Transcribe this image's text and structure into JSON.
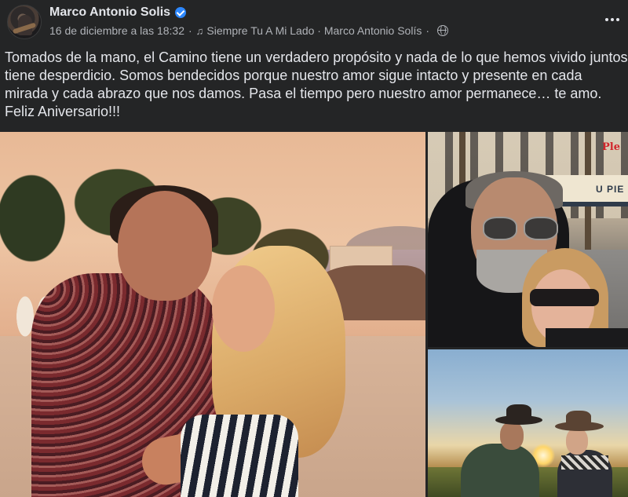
{
  "post": {
    "author": "Marco Antonio Solis",
    "date": "16 de diciembre a las 18:32",
    "separator": "·",
    "song": "Siempre Tu A Mi Lado · Marco Antonio Solís",
    "audience_icon": "globe-icon",
    "music_icon": "music-note-icon",
    "verified": true,
    "caption": "Tomados de la mano, el Camino tiene un verdadero propósito y nada de lo que hemos vivido juntos tiene desperdicio. Somos bendecidos porque nuestro amor sigue intacto y presente en cada mirada y cada abrazo que nos damos. Pasa el tiempo pero nuestro amor permanece… te amo. Feliz Aniversario!!!"
  },
  "photos": {
    "top_right_sign": "Ple",
    "top_right_awning": "U PIE"
  },
  "colors": {
    "background": "#242526",
    "text_primary": "#e4e6eb",
    "text_secondary": "#b0b3b8",
    "verified_badge": "#2d88ff"
  }
}
